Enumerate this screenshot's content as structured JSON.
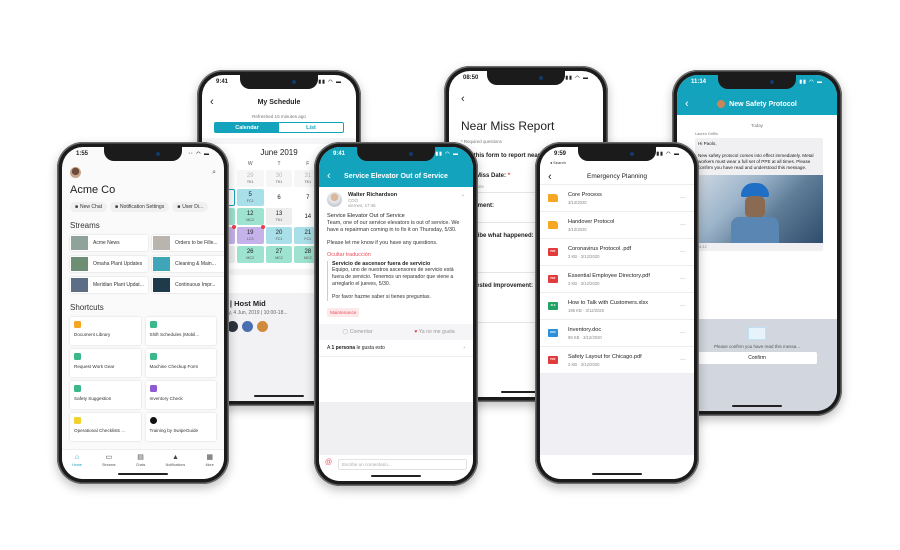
{
  "phone_home": {
    "time": "1:55",
    "title": "Acme Co",
    "chips": [
      {
        "icon": "chat-icon",
        "label": "New Chat"
      },
      {
        "icon": "bell-icon",
        "label": "Notification Settings"
      },
      {
        "icon": "users-icon",
        "label": "User Di..."
      }
    ],
    "streams_heading": "Streams",
    "streams": [
      {
        "label": "Acme News",
        "color": "#8fa39a"
      },
      {
        "label": "Orders to be Fille...",
        "color": "#b9b5ae"
      },
      {
        "label": "Omaha Plant Updates",
        "color": "#6f8f74"
      },
      {
        "label": "Cleaning & Main...",
        "color": "#3fa6b7"
      },
      {
        "label": "Meridian Plant Updat...",
        "color": "#5c6e86"
      },
      {
        "label": "Continuous Impr...",
        "color": "#1f3a4a"
      }
    ],
    "shortcuts_heading": "Shortcuts",
    "shortcuts": [
      {
        "label": "Document Library",
        "icon": "folder-icon",
        "color": "#f5a623"
      },
      {
        "label": "Shift Schedules (Mobil...",
        "icon": "calendar-icon",
        "color": "#3cb98a"
      },
      {
        "label": "Request Work Gear",
        "icon": "form-icon",
        "color": "#3cb98a"
      },
      {
        "label": "Machine Checkup Form",
        "icon": "check-icon",
        "color": "#3cb98a"
      },
      {
        "label": "Safety Suggestion",
        "icon": "form-icon",
        "color": "#3cb98a"
      },
      {
        "label": "Inventory Check",
        "icon": "checkbox-icon",
        "color": "#8e5bd4"
      },
      {
        "label": "Operational Checklists ...",
        "icon": "link-icon",
        "color": "#f2d230"
      },
      {
        "label": "Training by SwipeGuide",
        "icon": "swipeguide-icon",
        "color": "#111111"
      }
    ],
    "tabs": [
      {
        "label": "Home",
        "icon": "home-icon",
        "active": true
      },
      {
        "label": "Streams",
        "icon": "streams-icon"
      },
      {
        "label": "Chats",
        "icon": "chats-icon"
      },
      {
        "label": "Notifications",
        "icon": "bell-icon"
      },
      {
        "label": "More",
        "icon": "grid-icon"
      }
    ]
  },
  "phone_schedule": {
    "time": "9:41",
    "title": "My Schedule",
    "refreshed": "Refreshed 15 minutes ago",
    "segments": [
      "Calendar",
      "List"
    ],
    "active_segment": "Calendar",
    "month": "June 2019",
    "weekdays": [
      "T",
      "W",
      "T",
      "F",
      ""
    ],
    "days": [
      {
        "d": "28",
        "s": "",
        "t": "dim"
      },
      {
        "d": "29",
        "s": "TK1",
        "t": "dim"
      },
      {
        "d": "30",
        "s": "TK1",
        "t": "dim"
      },
      {
        "d": "31",
        "s": "TK1",
        "t": "dim"
      },
      {
        "d": "",
        "s": "",
        "t": ""
      },
      {
        "d": "4",
        "s": "FC1",
        "t": "sel"
      },
      {
        "d": "5",
        "s": "FC1",
        "t": "fc"
      },
      {
        "d": "6",
        "s": "",
        "t": ""
      },
      {
        "d": "7",
        "s": "",
        "t": ""
      },
      {
        "d": "",
        "s": "",
        "t": "lc"
      },
      {
        "d": "11",
        "s": "MC2",
        "t": "mc"
      },
      {
        "d": "12",
        "s": "MC2",
        "t": "mc"
      },
      {
        "d": "13",
        "s": "TK1",
        "t": "tk"
      },
      {
        "d": "14",
        "s": "",
        "t": ""
      },
      {
        "d": "",
        "s": "",
        "t": ""
      },
      {
        "d": "18",
        "s": "LC3",
        "t": "lc",
        "dot": true
      },
      {
        "d": "19",
        "s": "LC3",
        "t": "lc",
        "dot": true
      },
      {
        "d": "20",
        "s": "FC1",
        "t": "fc"
      },
      {
        "d": "21",
        "s": "FC1",
        "t": "fc"
      },
      {
        "d": "",
        "s": "",
        "t": ""
      },
      {
        "d": "25",
        "s": "Vac",
        "t": "tk"
      },
      {
        "d": "26",
        "s": "MC2",
        "t": "mc"
      },
      {
        "d": "27",
        "s": "MC2",
        "t": "mc"
      },
      {
        "d": "28",
        "s": "MC2",
        "t": "mc"
      },
      {
        "d": "",
        "s": "",
        "t": "mc"
      }
    ],
    "shift_title": "MC2 | Host Mid",
    "shift_time": "Tuesday, 4 Jun, 2019 | 10:00-18...",
    "attendee_colors": [
      "#3b4a63",
      "#2c3440",
      "#4a6fb0",
      "#d08a3c"
    ]
  },
  "phone_post": {
    "time": "9:41",
    "title": "Service Elevator Out of Service",
    "author": "Walter Richardson",
    "role": "COO",
    "when": "viernes, 17:46",
    "post_title": "Service Elevator Out of Service",
    "body_1": "Team, one of our service elevators is out of service. We have a repairman coming in to fix it on Thursday, 5/30.",
    "body_2": "Please let me know if you have any questions.",
    "hide_translation": "Ocultar traducción",
    "tr_title": "Servicio de ascensor fuera de servicio",
    "tr_body_1": "Equipo, uno de nuestros ascensores de servicio está fuera de servicio. Tenemos un reparador que viene a arreglarlo el jueves, 5/30.",
    "tr_body_2": "Por favor hazme saber si tienes preguntas.",
    "tag": "Maintenance",
    "comment_label": "Comentar",
    "like_label": "Ya no me gusta",
    "likes_prefix": "A ",
    "likes_bold": "1 persona",
    "likes_suffix": " le gusta esto",
    "comment_placeholder": "Escribe un comentario...",
    "accent": "#13a3bd",
    "red": "#ef4e5a"
  },
  "phone_form": {
    "time": "08:50",
    "title": "Near Miss Report",
    "required_note": "* Required questions",
    "intro": "Use this form to report near miss...",
    "fields": [
      {
        "label": "Near Miss Date:",
        "required": true,
        "placeholder": "Select date"
      },
      {
        "label": "Equipment:",
        "required": false,
        "placeholder": ""
      },
      {
        "label": "Describe what happened:",
        "required": false,
        "placeholder": ""
      },
      {
        "label": "Suggested Improvement:",
        "required": false,
        "placeholder": ""
      }
    ]
  },
  "phone_files": {
    "time": "9:59",
    "back_app": "◂ Search",
    "title": "Emergency Planning",
    "files": [
      {
        "name": "Core Process",
        "meta": "3/12/2020",
        "type": "folder"
      },
      {
        "name": "Handover Protocol",
        "meta": "3/12/2020",
        "type": "folder"
      },
      {
        "name": "Coronavirus Protocol .pdf",
        "meta": "3 KB · 3/12/2020",
        "type": "pdf"
      },
      {
        "name": "Essential Employee Directory.pdf",
        "meta": "3 KB · 3/12/2020",
        "type": "pdf"
      },
      {
        "name": "How to Talk with Customers.xlsx",
        "meta": "195 KB · 3/12/2020",
        "type": "xls"
      },
      {
        "name": "Inventory.doc",
        "meta": "98 KB · 3/12/2020",
        "type": "doc"
      },
      {
        "name": "Safety Layout for Chicago.pdf",
        "meta": "3 KB · 3/12/2020",
        "type": "pdf"
      }
    ],
    "type_labels": {
      "pdf": "PDF",
      "xls": "XLS",
      "doc": "DOC"
    },
    "type_colors": {
      "folder": "#f5a623",
      "pdf": "#e23b3b",
      "xls": "#21a366",
      "doc": "#2b90d9"
    }
  },
  "phone_chat": {
    "time": "11:14",
    "title": "New Safety Protocol",
    "day": "Today",
    "sender": "Lauren Griffin",
    "greeting": "Hi Paolo,",
    "message": "New safety protocol comes into effect immediately. Metal workers must wear a full set of PPE at all times. Please confirm you have read and understood this message.",
    "msg_time": "11:12",
    "confirm_prompt": "Please confirm you have read this messa...",
    "confirm_label": "Confirm"
  }
}
